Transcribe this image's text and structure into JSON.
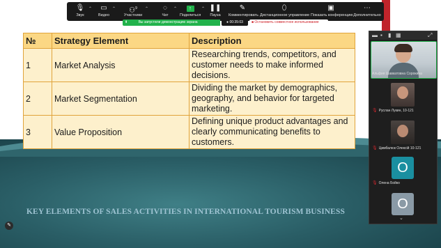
{
  "toolbar": {
    "items": [
      {
        "label": "Звук",
        "icon": "microphone-icon"
      },
      {
        "label": "Видео",
        "icon": "video-camera-icon"
      },
      {
        "label": "Участники",
        "icon": "participants-icon",
        "badge": "9"
      },
      {
        "label": "Чат",
        "icon": "chat-icon"
      },
      {
        "label": "Поделиться",
        "icon": "share-arrow-icon"
      },
      {
        "label": "Пауза",
        "icon": "pause-icon"
      },
      {
        "label": "Комментировать",
        "icon": "pencil-icon"
      },
      {
        "label": "Дистанционное управление",
        "icon": "mouse-icon"
      },
      {
        "label": "Показать конференцию",
        "icon": "monitor-icon"
      },
      {
        "label": "Дополнительно",
        "icon": "more-icon"
      }
    ],
    "share_status": "Вы запустили демонстрацию экрана",
    "timer": "00:35:03",
    "stop_shared_use": "Остановить совместное использование",
    "colors": {
      "accent_green": "#21b24b",
      "stop_red": "#d0262d"
    }
  },
  "slide": {
    "table": {
      "headers": [
        "№",
        "Strategy Element",
        "Description"
      ],
      "rows": [
        {
          "num": "1",
          "element": "Market Analysis",
          "description": "Researching trends, competitors, and customer needs to make informed decisions."
        },
        {
          "num": "2",
          "element": "Market Segmentation",
          "description": "Dividing the market by demographics, geography, and behavior for targeted marketing."
        },
        {
          "num": "3",
          "element": "Value Proposition",
          "description": "Defining unique product advantages and clearly communicating benefits to customers."
        }
      ]
    },
    "title": "KEY ELEMENTS OF SALES ACTIVITIES IN INTERNATIONAL TOURISM BUSINESS",
    "colors": {
      "header_fill": "#fbd784",
      "cell_fill": "#fdf0cc",
      "border": "#e0a33a",
      "accent_red": "#c0242b",
      "teal": "#2a5e66"
    }
  },
  "participants": [
    {
      "name": "Альфия Шавкатовна Сорокина",
      "type": "video"
    },
    {
      "name": "Руслан Лукин, 10-121",
      "type": "photo"
    },
    {
      "name": "Цимбалюк Олексій 10-121",
      "type": "photo"
    },
    {
      "name": "Олена Бойко",
      "type": "letter",
      "letter": "О",
      "color": "#1a8fa0"
    },
    {
      "name": "",
      "type": "letter",
      "letter": "О",
      "color": "#8a9aa6"
    }
  ]
}
